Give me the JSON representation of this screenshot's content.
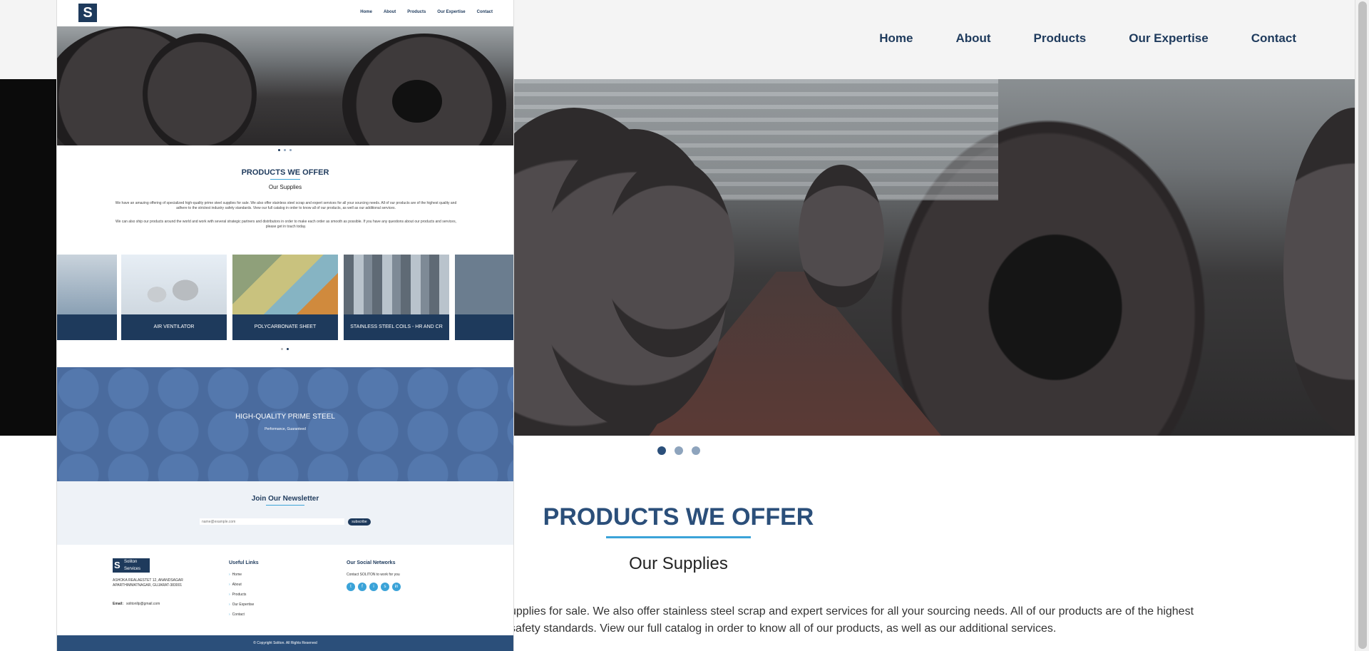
{
  "nav": [
    "Home",
    "About",
    "Products",
    "Our Expertise",
    "Contact"
  ],
  "logo": "S",
  "products": {
    "title": "PRODUCTS WE OFFER",
    "subtitle": "Our Supplies",
    "para1": "We have an amazing offering of specialized high-quality prime steel supplies for sale. We also offer stainless steel scrap and expert services for all your sourcing needs. All of our products are of the highest quality and adhere to the strictest industry safety standards. View our full catalog in order to know all of our products, as well as our additional services.",
    "para2": "We can also ship our products around the world and work with several strategic partners and distributors in order to make each order as smooth as possible. If you have any questions about our products and services, please get in touch today.",
    "bg_para": "upplies for sale. We also offer stainless steel scrap and expert services for all your sourcing needs. All of our products are of the highest safety standards. View our full catalog in order to know all of our products, as well as our additional services."
  },
  "cards": [
    "AIR VENTILATOR",
    "POLYCARBONATE SHEET",
    "STAINLESS STEEL COILS - HR AND CR"
  ],
  "carousel_arrows": {
    "prev": "‹",
    "next": "›"
  },
  "banner": {
    "title": "HIGH-QUALITY PRIME STEEL",
    "subtitle": "Performance, Guaranteed"
  },
  "newsletter": {
    "title": "Join Our Newsletter",
    "placeholder": "name@example.com",
    "button": "subscribe"
  },
  "footer": {
    "logo_line1": "Soliton",
    "logo_line2": "Services",
    "address": "ASHOKA REALAESTET 12, ANANDSAGAR APARTHIMMATNAGAR, GUJARAT-383001",
    "email_label": "Email:",
    "email": "solitonllp@gmail.com",
    "links_title": "Useful Links",
    "links": [
      "Home",
      "About",
      "Products",
      "Our Expertise",
      "Contact"
    ],
    "social_title": "Our Social Networks",
    "social_text": "Contact SOLITON to work for you",
    "social_icons": [
      "t",
      "f",
      "i",
      "s",
      "in"
    ],
    "copyright": "© Copyright Soliton. All Rights Reserved"
  },
  "colors": {
    "brand": "#1e3a5c",
    "accent": "#3ba3d8",
    "banner": "#4a6b9e"
  }
}
